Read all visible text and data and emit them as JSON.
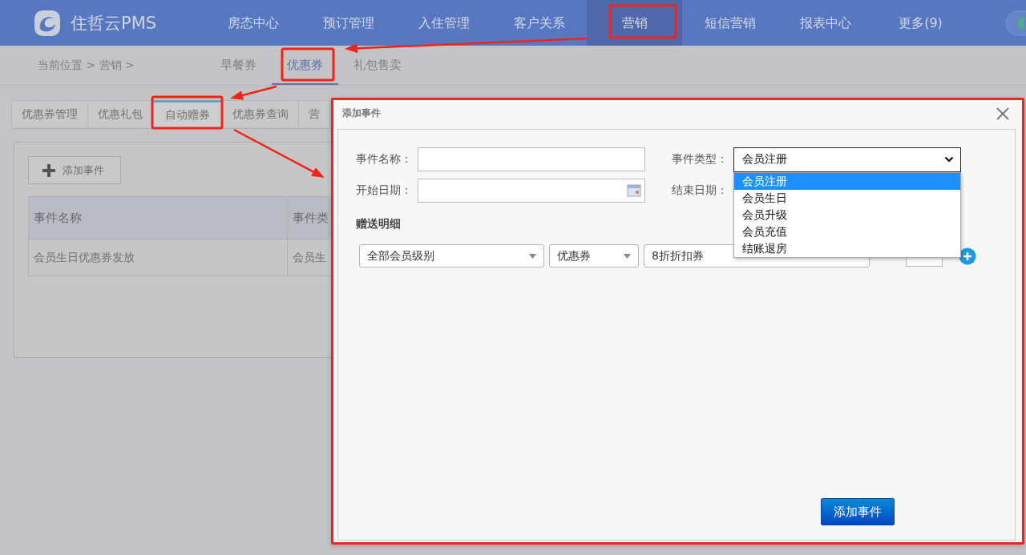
{
  "app": {
    "logo": "住哲云PMS"
  },
  "nav": [
    {
      "label": "房态中心",
      "selected": false
    },
    {
      "label": "预订管理",
      "selected": false
    },
    {
      "label": "入住管理",
      "selected": false
    },
    {
      "label": "客户关系",
      "selected": false
    },
    {
      "label": "营销",
      "selected": true
    },
    {
      "label": "短信营销",
      "selected": false
    },
    {
      "label": "报表中心",
      "selected": false
    },
    {
      "label": "更多(9)",
      "selected": false
    }
  ],
  "breadcrumb": "当前位置 > 营销 >",
  "sub_tabs": [
    {
      "label": "早餐券",
      "selected": false
    },
    {
      "label": "优惠券",
      "selected": true
    },
    {
      "label": "礼包售卖",
      "selected": false
    }
  ],
  "tabs": [
    {
      "label": "优惠券管理",
      "selected": false
    },
    {
      "label": "优惠礼包",
      "selected": false
    },
    {
      "label": "自动赠券",
      "selected": true
    },
    {
      "label": "优惠券查询",
      "selected": false
    },
    {
      "label": "营",
      "selected": false
    }
  ],
  "add_button": "添加事件",
  "table": {
    "columns": [
      "事件名称",
      "事件类"
    ],
    "rows": [
      [
        "会员生日优惠券发放",
        "会员生"
      ]
    ]
  },
  "dialog": {
    "title": "添加事件",
    "name_label": "事件名称：",
    "type_label": "事件类型：",
    "type_value": "会员注册",
    "type_options": [
      {
        "label": "会员注册",
        "selected": true
      },
      {
        "label": "会员生日",
        "selected": false
      },
      {
        "label": "会员升级",
        "selected": false
      },
      {
        "label": "会员充值",
        "selected": false
      },
      {
        "label": "结账退房",
        "selected": false
      }
    ],
    "start_label": "开始日期：",
    "end_label": "结束日期：",
    "section": "赠送明细",
    "level_select": "全部会员级别",
    "kind_select": "优惠券",
    "coupon_select": "8折折扣券",
    "submit": "添加事件"
  }
}
